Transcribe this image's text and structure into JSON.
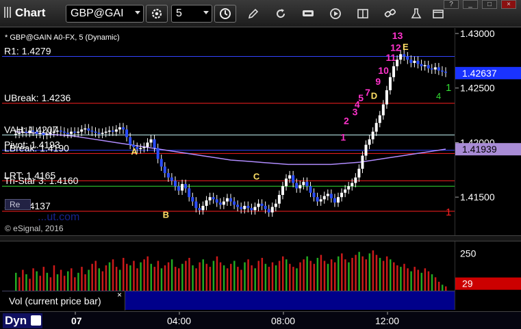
{
  "toolbar": {
    "app_title": "Chart",
    "symbol": "GBP@GAI",
    "interval": "5",
    "window_controls": [
      "?",
      "_",
      "□",
      "×"
    ]
  },
  "chart_header": {
    "title": "* GBP@GAIN A0-FX, 5 (Dynamic)",
    "watermark": "© eSignal, 2016",
    "source_overlay": "Re",
    "faded_url": "...ut.com"
  },
  "levels": [
    {
      "label": "R1: 1.4279",
      "price": 1.4279,
      "color": "#3344ff"
    },
    {
      "label": "UBreak: 1.4236",
      "price": 1.4236,
      "color": "#ff2020"
    },
    {
      "label": "VAH: 1.4207",
      "price": 1.4207,
      "color": "#ccffff"
    },
    {
      "label": "Pivot: 1.4193",
      "price": 1.4193,
      "color": "#3344ff"
    },
    {
      "label": "LBreak: 1.4190",
      "price": 1.419,
      "color": "#ff2020"
    },
    {
      "label": "LRT: 1.4165",
      "price": 1.4165,
      "color": "#ff2020"
    },
    {
      "label": "Tri-Star 3: 1.4160",
      "price": 1.416,
      "color": "#33dd33"
    },
    {
      "label": "S1: 1.4137",
      "price": 1.4137,
      "color": "#ff2020"
    }
  ],
  "chart_data": {
    "type": "line",
    "title": "* GBP@GAIN A0-FX, 5 (Dynamic)",
    "ylim": [
      1.4115,
      1.4305
    ],
    "y_ticks": [
      1.43,
      1.425,
      1.42,
      1.415
    ],
    "y_tick_labels": [
      "1.43000",
      "1.42500",
      "1.42000",
      "1.41500"
    ],
    "current_price": 1.42637,
    "current_price_label": "1.42637",
    "ma_price": 1.41939,
    "ma_price_label": "1.41939",
    "x_labels": [
      "07",
      "04:00",
      "08:00",
      "12:00"
    ],
    "series": [
      {
        "values": [
          1.4208,
          1.4209,
          1.421,
          1.4209,
          1.4211,
          1.421,
          1.4208,
          1.4209,
          1.4207,
          1.4208,
          1.4209,
          1.421,
          1.4211,
          1.421,
          1.4209,
          1.4208,
          1.421,
          1.4209,
          1.421,
          1.4212,
          1.4213,
          1.4211,
          1.421,
          1.4209,
          1.4208,
          1.4209,
          1.421,
          1.4211,
          1.421,
          1.4212,
          1.4214,
          1.4212,
          1.4205,
          1.4198,
          1.4196,
          1.4194,
          1.4195,
          1.4196,
          1.42,
          1.4203,
          1.4195,
          1.4185,
          1.4178,
          1.4172,
          1.4168,
          1.4165,
          1.416,
          1.4156,
          1.4162,
          1.4158,
          1.415,
          1.4146,
          1.414,
          1.4138,
          1.4142,
          1.4147,
          1.415,
          1.4148,
          1.4145,
          1.4143,
          1.4146,
          1.4149,
          1.4146,
          1.4143,
          1.4141,
          1.4139,
          1.4142,
          1.414,
          1.4138,
          1.4141,
          1.4144,
          1.4142,
          1.4139,
          1.4136,
          1.4141,
          1.4144,
          1.4152,
          1.416,
          1.4167,
          1.417,
          1.4163,
          1.4158,
          1.4161,
          1.4164,
          1.416,
          1.4154,
          1.415,
          1.4146,
          1.4148,
          1.4151,
          1.4153,
          1.4149,
          1.4145,
          1.415,
          1.4154,
          1.4157,
          1.416,
          1.4163,
          1.4168,
          1.4176,
          1.4188,
          1.4198,
          1.4203,
          1.421,
          1.4218,
          1.4225,
          1.4235,
          1.4248,
          1.426,
          1.427,
          1.4276,
          1.4281,
          1.4279,
          1.4276,
          1.4273,
          1.4275,
          1.4272,
          1.427,
          1.4271,
          1.4268,
          1.4267,
          1.4269,
          1.4266,
          1.4265,
          1.4264
        ],
        "name": ""
      },
      {
        "values": [
          1.421,
          1.4209,
          1.4208,
          1.4207,
          1.4206,
          1.4204,
          1.4202,
          1.42,
          1.4198,
          1.4196,
          1.4194,
          1.4192,
          1.419,
          1.4188,
          1.4186,
          1.4184,
          1.4183,
          1.4182,
          1.4181,
          1.418,
          1.418,
          1.418,
          1.418,
          1.4181,
          1.4182,
          1.4184,
          1.4186,
          1.4188,
          1.419,
          1.4192,
          1.4194
        ],
        "name": ""
      }
    ],
    "tick_marks": [
      {
        "text": "A",
        "x": 0.285,
        "price": 1.4189,
        "color": "#ffe066"
      },
      {
        "text": "B",
        "x": 0.355,
        "price": 1.4131,
        "color": "#ffe066"
      },
      {
        "text": "C",
        "x": 0.555,
        "price": 1.4166,
        "color": "#ffe066"
      },
      {
        "text": "D",
        "x": 0.815,
        "price": 1.424,
        "color": "#ffe066"
      },
      {
        "text": "E",
        "x": 0.885,
        "price": 1.4285,
        "color": "#ffe066"
      }
    ],
    "td_counts": [
      {
        "text": "1",
        "x": 0.748,
        "price": 1.4202
      },
      {
        "text": "2",
        "x": 0.755,
        "price": 1.4217
      },
      {
        "text": "3",
        "x": 0.774,
        "price": 1.4225
      },
      {
        "text": "4",
        "x": 0.779,
        "price": 1.4232
      },
      {
        "text": "5",
        "x": 0.787,
        "price": 1.4238
      },
      {
        "text": "7",
        "x": 0.802,
        "price": 1.4243
      },
      {
        "text": "9",
        "x": 0.825,
        "price": 1.4253
      },
      {
        "text": "10",
        "x": 0.831,
        "price": 1.4263
      },
      {
        "text": "11",
        "x": 0.848,
        "price": 1.4275
      },
      {
        "text": "12",
        "x": 0.858,
        "price": 1.4284
      },
      {
        "text": "13",
        "x": 0.862,
        "price": 1.4295
      }
    ],
    "red_marker": {
      "text": "1",
      "price": 1.4137
    },
    "green_marker": {
      "text": "1",
      "price": 1.4251
    },
    "green_marker_small": {
      "text": "4",
      "price": 1.4246
    },
    "volume": {
      "y_ticks": [
        250
      ],
      "y_tick_labels": [
        "250"
      ],
      "current_label": "29",
      "ylim": [
        0,
        330
      ],
      "values": [
        120,
        90,
        140,
        110,
        80,
        150,
        130,
        100,
        160,
        120,
        90,
        170,
        110,
        140,
        100,
        130,
        150,
        90,
        120,
        160,
        110,
        140,
        180,
        200,
        150,
        130,
        170,
        190,
        210,
        160,
        140,
        220,
        180,
        170,
        200,
        150,
        190,
        210,
        230,
        180,
        160,
        200,
        150,
        170,
        190,
        210,
        160,
        150,
        180,
        200,
        220,
        170,
        150,
        190,
        210,
        180,
        160,
        200,
        230,
        190,
        170,
        150,
        180,
        200,
        160,
        140,
        190,
        210,
        170,
        150,
        200,
        220,
        180,
        160,
        190,
        170,
        200,
        230,
        210,
        180,
        160,
        150,
        190,
        210,
        230,
        200,
        180,
        220,
        240,
        200,
        180,
        210,
        190,
        230,
        250,
        210,
        190,
        220,
        240,
        260,
        230,
        210,
        250,
        270,
        240,
        220,
        200,
        230,
        210,
        190,
        170,
        160,
        180,
        150,
        130,
        160,
        140,
        120,
        150,
        130,
        110,
        90,
        60,
        40,
        29
      ],
      "pane_label": "Vol (current price bar)"
    }
  },
  "bottom": {
    "dyn_label": "Dyn"
  }
}
